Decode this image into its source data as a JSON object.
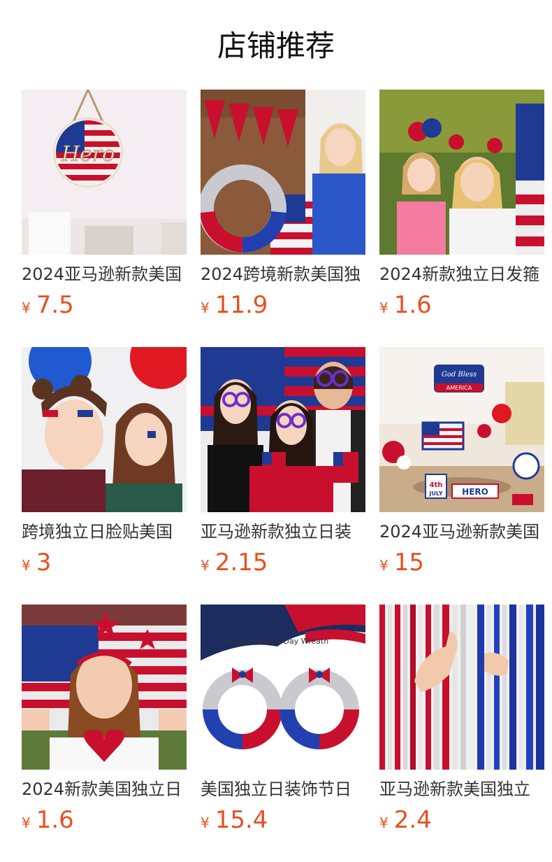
{
  "header": {
    "title": "店铺推荐"
  },
  "currency_symbol": "¥",
  "products": [
    {
      "name": "2024亚马逊新款美国",
      "price": "7.5"
    },
    {
      "name": "2024跨境新款美国独",
      "price": "11.9"
    },
    {
      "name": "2024新款独立日发箍",
      "price": "1.6"
    },
    {
      "name": "跨境独立日脸贴美国",
      "price": "3"
    },
    {
      "name": "亚马逊新款独立日装",
      "price": "2.15"
    },
    {
      "name": "2024亚马逊新款美国",
      "price": "15"
    },
    {
      "name": "2024新款美国独立日",
      "price": "1.6"
    },
    {
      "name": "美国独立日装饰节日",
      "price": "15.4"
    },
    {
      "name": "亚马逊新款美国独立",
      "price": "2.4"
    }
  ],
  "image_text": {
    "sign": "Hero",
    "wreath_banner": "Independence Day Wreath",
    "tray_sign": "God Bless AMERICA",
    "tray_plaque": "4th JULY",
    "tray_hero": "HERO"
  },
  "colors": {
    "price": "#e8501f",
    "flag_red": "#c8102e",
    "flag_blue": "#1f3a93"
  }
}
